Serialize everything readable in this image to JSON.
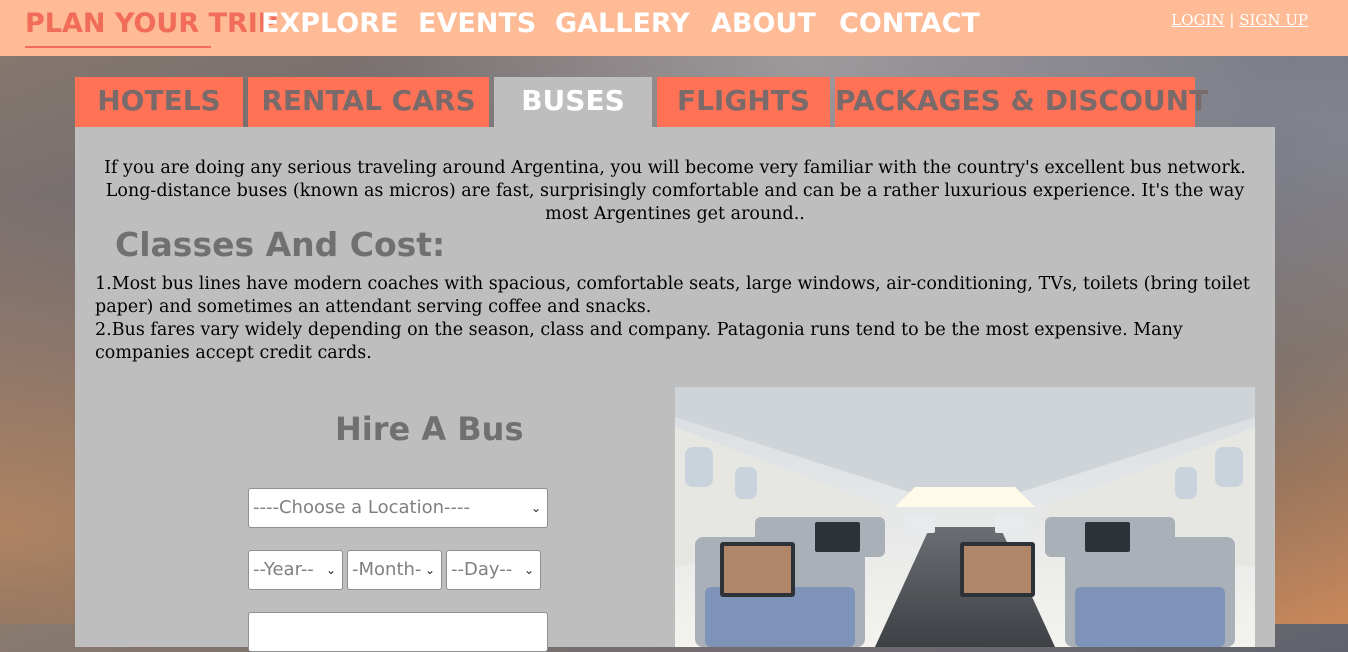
{
  "nav": {
    "brand": "PLAN YOUR TRIP",
    "items": [
      "EXPLORE",
      "EVENTS",
      "GALLERY",
      "ABOUT",
      "CONTACT"
    ],
    "login": "LOGIN",
    "separator": "|",
    "signup": "SIGN UP"
  },
  "tabs": [
    {
      "label": "HOTELS",
      "active": false
    },
    {
      "label": "RENTAL CARS",
      "active": false
    },
    {
      "label": "BUSES",
      "active": true
    },
    {
      "label": "FLIGHTS",
      "active": false
    },
    {
      "label": "PACKAGES & DISCOUNT",
      "active": false
    }
  ],
  "content": {
    "intro": "If you are doing any serious traveling around Argentina, you will become very familiar with the country's excellent bus network. Long-distance buses (known as micros) are fast, surprisingly comfortable and can be a rather luxurious experience. It's the way most Argentines get around..",
    "section_title": "Classes And Cost:",
    "point1": "1.Most bus lines have modern coaches with spacious, comfortable seats, large windows, air-conditioning, TVs, toilets (bring toilet paper) and sometimes an attendant serving coffee and snacks.",
    "point2": "2.Bus fares vary widely depending on the season, class and company. Patagonia runs tend to be the most expensive. Many companies accept credit cards."
  },
  "form": {
    "title": "Hire A Bus",
    "location": "----Choose a Location----",
    "year": "--Year--",
    "month": "-Month-",
    "day": "--Day--"
  },
  "colors": {
    "topbar": "#ffbb96",
    "brand": "#f26c5a",
    "tab": "#ff7256",
    "panel": "#bebebe"
  },
  "icons": {
    "select_arrow": "chevron-down-icon"
  }
}
